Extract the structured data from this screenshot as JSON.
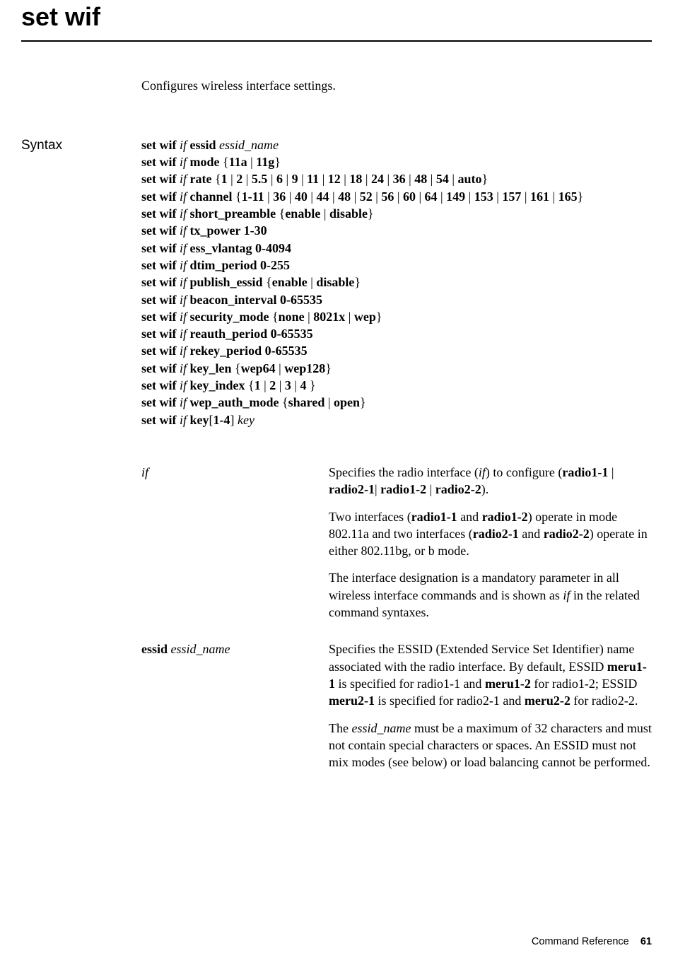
{
  "title": "set wif",
  "description": "Configures wireless interface settings.",
  "syntax_label": "Syntax",
  "chart_data": {
    "type": "table",
    "title": "set wif command syntax and parameters",
    "syntax_lines": [
      {
        "prefix": "set wif ",
        "param": "if ",
        "keyword": "essid ",
        "arg_i": "essid_name"
      },
      {
        "prefix": "set wif ",
        "param": "if ",
        "keyword": "mode ",
        "options": [
          "11a",
          "11g"
        ]
      },
      {
        "prefix": "set wif ",
        "param": "if ",
        "keyword": "rate ",
        "options": [
          "1",
          "2",
          "5.5",
          "6",
          "9",
          "11",
          "12",
          "18",
          "24",
          "36",
          "48",
          "54",
          "auto"
        ]
      },
      {
        "prefix": "set wif ",
        "param": "if ",
        "keyword": "channel ",
        "options": [
          "1-11",
          "36",
          "40",
          "44",
          "48",
          "52",
          "56",
          "60",
          "64",
          "149",
          "153",
          "157",
          "161",
          "165"
        ]
      },
      {
        "prefix": "set wif ",
        "param": "if ",
        "keyword": "short_preamble ",
        "options": [
          "enable",
          "disable"
        ]
      },
      {
        "prefix": "set wif ",
        "param": "if ",
        "keyword": "tx_power 1-30"
      },
      {
        "prefix": "set wif ",
        "param": "if ",
        "keyword": "ess_vlantag 0-4094"
      },
      {
        "prefix": "set wif ",
        "param": "if ",
        "keyword": "dtim_period 0-255"
      },
      {
        "prefix": "set wif ",
        "param": "if ",
        "keyword": "publish_essid ",
        "options": [
          "enable",
          "disable"
        ]
      },
      {
        "prefix": "set wif ",
        "param": "if ",
        "keyword": "beacon_interval 0-65535"
      },
      {
        "prefix": "set wif ",
        "param": "if ",
        "keyword": "security_mode ",
        "options": [
          "none",
          "8021x",
          "wep"
        ]
      },
      {
        "prefix": "set wif ",
        "param": "if ",
        "keyword": "reauth_period 0-65535"
      },
      {
        "prefix": "set wif ",
        "param": "if ",
        "keyword": "rekey_period 0-65535"
      },
      {
        "prefix": "set wif ",
        "param": "if ",
        "keyword": "key_len ",
        "options": [
          "wep64",
          "wep128"
        ]
      },
      {
        "prefix": "set wif ",
        "param": "if ",
        "keyword": "key_index ",
        "options": [
          "1",
          "2",
          "3",
          "4 "
        ]
      },
      {
        "prefix": "set wif ",
        "param": "if ",
        "keyword": "wep_auth_mode ",
        "options": [
          "shared",
          "open"
        ]
      },
      {
        "prefix": "set wif ",
        "param": "if ",
        "keyword": "key",
        "bracket": "[1-4] ",
        "arg_i": "key"
      }
    ],
    "parameters": [
      {
        "name_italic": "if",
        "desc": [
          {
            "type": "mixed",
            "parts": [
              {
                "t": "Specifies the radio interface ("
              },
              {
                "i": "if"
              },
              {
                "t": ") to configure ("
              },
              {
                "b": "radio1-1"
              },
              {
                "t": " | "
              },
              {
                "b": "radio2-1"
              },
              {
                "t": "| "
              },
              {
                "b": "radio1-2"
              },
              {
                "t": " | "
              },
              {
                "b": "radio2-2"
              },
              {
                "t": ")."
              }
            ]
          },
          {
            "type": "mixed",
            "parts": [
              {
                "t": "Two interfaces ("
              },
              {
                "b": "radio1-1"
              },
              {
                "t": " and "
              },
              {
                "b": "radio1-2"
              },
              {
                "t": ") operate in mode 802.11a and two interfaces ("
              },
              {
                "b": "radio2-1"
              },
              {
                "t": " and "
              },
              {
                "b": "radio2-2"
              },
              {
                "t": ") operate in either 802.11bg, or b mode."
              }
            ]
          },
          {
            "type": "mixed",
            "parts": [
              {
                "t": "The interface designation is a mandatory parameter in all wireless interface commands and is shown as "
              },
              {
                "i": "if"
              },
              {
                "t": " in the related command syntaxes."
              }
            ]
          }
        ]
      },
      {
        "name_bold": "essid ",
        "name_italic": "essid_name",
        "desc": [
          {
            "type": "mixed",
            "parts": [
              {
                "t": "Specifies the ESSID (Extended Service Set Identifier) name associated with the radio interface. By default, ESSID "
              },
              {
                "b": "meru1-1"
              },
              {
                "t": " is specified for radio1-1 and "
              },
              {
                "b": "meru1-2"
              },
              {
                "t": " for radio1-2; ESSID "
              },
              {
                "b": "meru2-1"
              },
              {
                "t": " is specified for radio2-1 and "
              },
              {
                "b": "meru2-2"
              },
              {
                "t": " for radio2-2."
              }
            ]
          },
          {
            "type": "mixed",
            "parts": [
              {
                "t": "The "
              },
              {
                "i": "essid_name"
              },
              {
                "t": " must be a maximum of 32 characters and must not contain special characters or spaces. An ESSID must not mix modes (see below) or load balancing cannot be performed."
              }
            ]
          }
        ]
      }
    ]
  },
  "footer": {
    "label": "Command Reference",
    "page": "61"
  }
}
